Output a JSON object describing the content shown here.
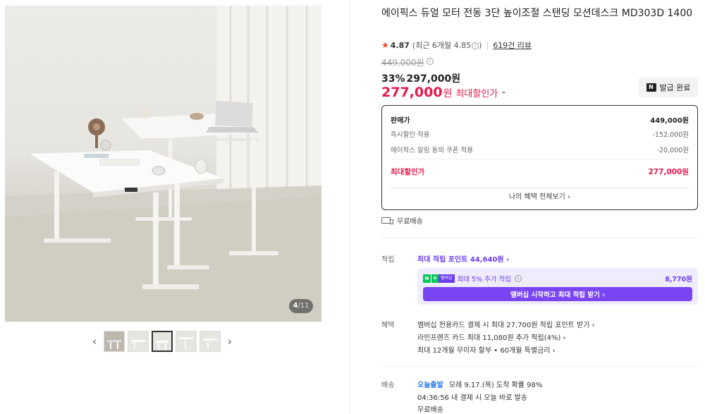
{
  "gallery": {
    "counter_current": "4",
    "counter_total": "/11",
    "prev_arrow": "‹",
    "next_arrow": "›"
  },
  "product": {
    "title": "에이픽스 듀얼 모터 전동 3단 높이조절 스탠딩 모션데스크 MD303D 1400",
    "rating": "4.87",
    "recent_rating": "(최근 6개월 4.85",
    "recent_rating_close": ")",
    "review_count": "619건 리뷰",
    "original_price": "449,000원",
    "discount_pct": "33%",
    "sale_price": "297,000원",
    "max_price": "277,000",
    "max_price_unit": "원",
    "max_price_label": "최대할인가",
    "coupon_button": "발급 완료"
  },
  "price_box": {
    "header_label": "판매가",
    "header_value": "449,000원",
    "rows": [
      {
        "label": "즉시할인 적용",
        "value": "-152,000원"
      },
      {
        "label": "에이픽스 알림 동의 쿠폰 적용",
        "value": "-20,000원"
      }
    ],
    "max_label": "최대할인가",
    "max_value": "277,000원",
    "view_all": "나의 혜택 전체보기 ›"
  },
  "shipping_free": "무료배송",
  "points": {
    "label": "적립",
    "link": "최대 적립 포인트 44,640원 ›",
    "member_badge": "멤버십",
    "member_text": "최대 5% 추가 적립",
    "member_amount": "8,770원",
    "member_button": "멤버십 시작하고 최대 적립 받기 ›"
  },
  "benefits": {
    "label": "혜택",
    "lines": [
      "멤버십 전용카드 결제 시 최대 27,700원 적립 포인트 받기 ›",
      "라인프렌즈 카드 최대 11,080원 추가 적립(4%) ›",
      "최대 12개월 무이자 할부 • 60개월 특별금리 ›"
    ]
  },
  "delivery": {
    "label": "배송",
    "today": "오늘출발",
    "eta": "모레 9.17.(목) 도착 확률 98%",
    "countdown": "04:36:56  내 결제 시 오늘 바로 발송",
    "fee": "무료배송"
  },
  "colors": {
    "accent_red": "#e7194d",
    "accent_purple": "#6b3df0",
    "accent_blue": "#2a78e8",
    "star": "#e8472d"
  }
}
